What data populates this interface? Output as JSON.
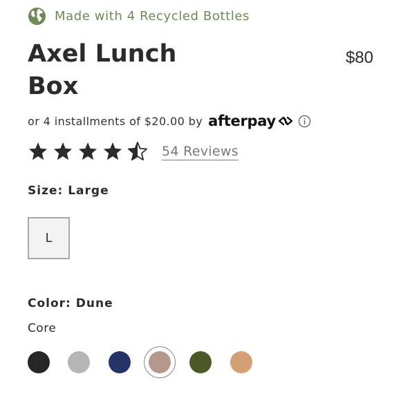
{
  "eco": {
    "icon": "globe-icon",
    "text": "Made with 4 Recycled Bottles",
    "color": "#6e8a56"
  },
  "product": {
    "title": "Axel Lunch Box",
    "price": "$80"
  },
  "afterpay": {
    "text": "or 4 installments of $20.00 by",
    "brand": "afterpay",
    "info_icon": "info-icon"
  },
  "rating": {
    "value": 4.5,
    "max": 5,
    "reviews_label": "54 Reviews"
  },
  "size": {
    "label": "Size: Large",
    "options": [
      "L"
    ],
    "selected": "L"
  },
  "color": {
    "label": "Color: Dune",
    "group": "Core",
    "swatches": [
      {
        "name": "black",
        "hex": "#262626"
      },
      {
        "name": "heather-grey",
        "hex": "#b5b5b5"
      },
      {
        "name": "navy",
        "hex": "#243466"
      },
      {
        "name": "dune",
        "hex": "#b6978c",
        "selected": true
      },
      {
        "name": "olive",
        "hex": "#4d5a26"
      },
      {
        "name": "tan",
        "hex": "#d3a073"
      }
    ]
  }
}
